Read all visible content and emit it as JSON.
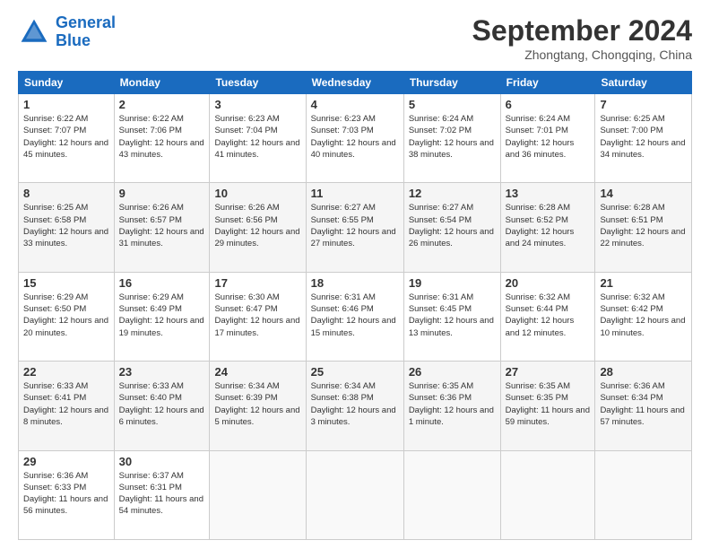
{
  "logo": {
    "text_general": "General",
    "text_blue": "Blue"
  },
  "header": {
    "month_year": "September 2024",
    "location": "Zhongtang, Chongqing, China"
  },
  "weekdays": [
    "Sunday",
    "Monday",
    "Tuesday",
    "Wednesday",
    "Thursday",
    "Friday",
    "Saturday"
  ],
  "weeks": [
    [
      {
        "day": "1",
        "sunrise": "6:22 AM",
        "sunset": "7:07 PM",
        "daylight": "12 hours and 45 minutes."
      },
      {
        "day": "2",
        "sunrise": "6:22 AM",
        "sunset": "7:06 PM",
        "daylight": "12 hours and 43 minutes."
      },
      {
        "day": "3",
        "sunrise": "6:23 AM",
        "sunset": "7:04 PM",
        "daylight": "12 hours and 41 minutes."
      },
      {
        "day": "4",
        "sunrise": "6:23 AM",
        "sunset": "7:03 PM",
        "daylight": "12 hours and 40 minutes."
      },
      {
        "day": "5",
        "sunrise": "6:24 AM",
        "sunset": "7:02 PM",
        "daylight": "12 hours and 38 minutes."
      },
      {
        "day": "6",
        "sunrise": "6:24 AM",
        "sunset": "7:01 PM",
        "daylight": "12 hours and 36 minutes."
      },
      {
        "day": "7",
        "sunrise": "6:25 AM",
        "sunset": "7:00 PM",
        "daylight": "12 hours and 34 minutes."
      }
    ],
    [
      {
        "day": "8",
        "sunrise": "6:25 AM",
        "sunset": "6:58 PM",
        "daylight": "12 hours and 33 minutes."
      },
      {
        "day": "9",
        "sunrise": "6:26 AM",
        "sunset": "6:57 PM",
        "daylight": "12 hours and 31 minutes."
      },
      {
        "day": "10",
        "sunrise": "6:26 AM",
        "sunset": "6:56 PM",
        "daylight": "12 hours and 29 minutes."
      },
      {
        "day": "11",
        "sunrise": "6:27 AM",
        "sunset": "6:55 PM",
        "daylight": "12 hours and 27 minutes."
      },
      {
        "day": "12",
        "sunrise": "6:27 AM",
        "sunset": "6:54 PM",
        "daylight": "12 hours and 26 minutes."
      },
      {
        "day": "13",
        "sunrise": "6:28 AM",
        "sunset": "6:52 PM",
        "daylight": "12 hours and 24 minutes."
      },
      {
        "day": "14",
        "sunrise": "6:28 AM",
        "sunset": "6:51 PM",
        "daylight": "12 hours and 22 minutes."
      }
    ],
    [
      {
        "day": "15",
        "sunrise": "6:29 AM",
        "sunset": "6:50 PM",
        "daylight": "12 hours and 20 minutes."
      },
      {
        "day": "16",
        "sunrise": "6:29 AM",
        "sunset": "6:49 PM",
        "daylight": "12 hours and 19 minutes."
      },
      {
        "day": "17",
        "sunrise": "6:30 AM",
        "sunset": "6:47 PM",
        "daylight": "12 hours and 17 minutes."
      },
      {
        "day": "18",
        "sunrise": "6:31 AM",
        "sunset": "6:46 PM",
        "daylight": "12 hours and 15 minutes."
      },
      {
        "day": "19",
        "sunrise": "6:31 AM",
        "sunset": "6:45 PM",
        "daylight": "12 hours and 13 minutes."
      },
      {
        "day": "20",
        "sunrise": "6:32 AM",
        "sunset": "6:44 PM",
        "daylight": "12 hours and 12 minutes."
      },
      {
        "day": "21",
        "sunrise": "6:32 AM",
        "sunset": "6:42 PM",
        "daylight": "12 hours and 10 minutes."
      }
    ],
    [
      {
        "day": "22",
        "sunrise": "6:33 AM",
        "sunset": "6:41 PM",
        "daylight": "12 hours and 8 minutes."
      },
      {
        "day": "23",
        "sunrise": "6:33 AM",
        "sunset": "6:40 PM",
        "daylight": "12 hours and 6 minutes."
      },
      {
        "day": "24",
        "sunrise": "6:34 AM",
        "sunset": "6:39 PM",
        "daylight": "12 hours and 5 minutes."
      },
      {
        "day": "25",
        "sunrise": "6:34 AM",
        "sunset": "6:38 PM",
        "daylight": "12 hours and 3 minutes."
      },
      {
        "day": "26",
        "sunrise": "6:35 AM",
        "sunset": "6:36 PM",
        "daylight": "12 hours and 1 minute."
      },
      {
        "day": "27",
        "sunrise": "6:35 AM",
        "sunset": "6:35 PM",
        "daylight": "11 hours and 59 minutes."
      },
      {
        "day": "28",
        "sunrise": "6:36 AM",
        "sunset": "6:34 PM",
        "daylight": "11 hours and 57 minutes."
      }
    ],
    [
      {
        "day": "29",
        "sunrise": "6:36 AM",
        "sunset": "6:33 PM",
        "daylight": "11 hours and 56 minutes."
      },
      {
        "day": "30",
        "sunrise": "6:37 AM",
        "sunset": "6:31 PM",
        "daylight": "11 hours and 54 minutes."
      },
      null,
      null,
      null,
      null,
      null
    ]
  ]
}
